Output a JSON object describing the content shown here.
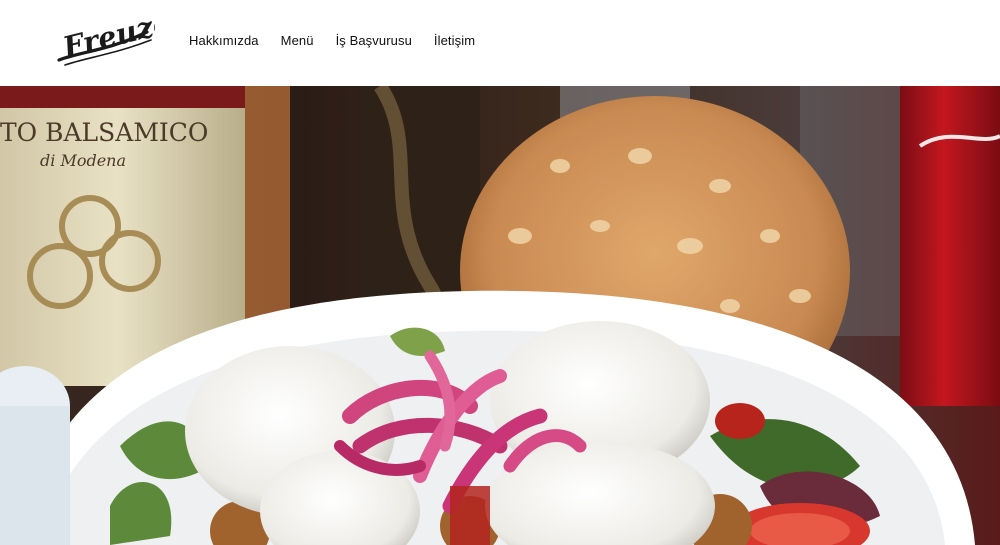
{
  "brand": {
    "logo_text": "Freuzé"
  },
  "nav": {
    "items": [
      {
        "label": "Hakkımızda"
      },
      {
        "label": "Menü"
      },
      {
        "label": "İş Başvurusu"
      },
      {
        "label": "İletişim"
      }
    ]
  },
  "hero": {
    "description": "Falafel bowl with pickled red onions, white sauce, salad, tomato and flatbread",
    "bottle_label": "TO BALSAMICO",
    "bottle_sublabel": "di Modena"
  },
  "colors": {
    "accent_pink": "#c0326e",
    "bread": "#c98a52",
    "can_red": "#b2141f"
  }
}
